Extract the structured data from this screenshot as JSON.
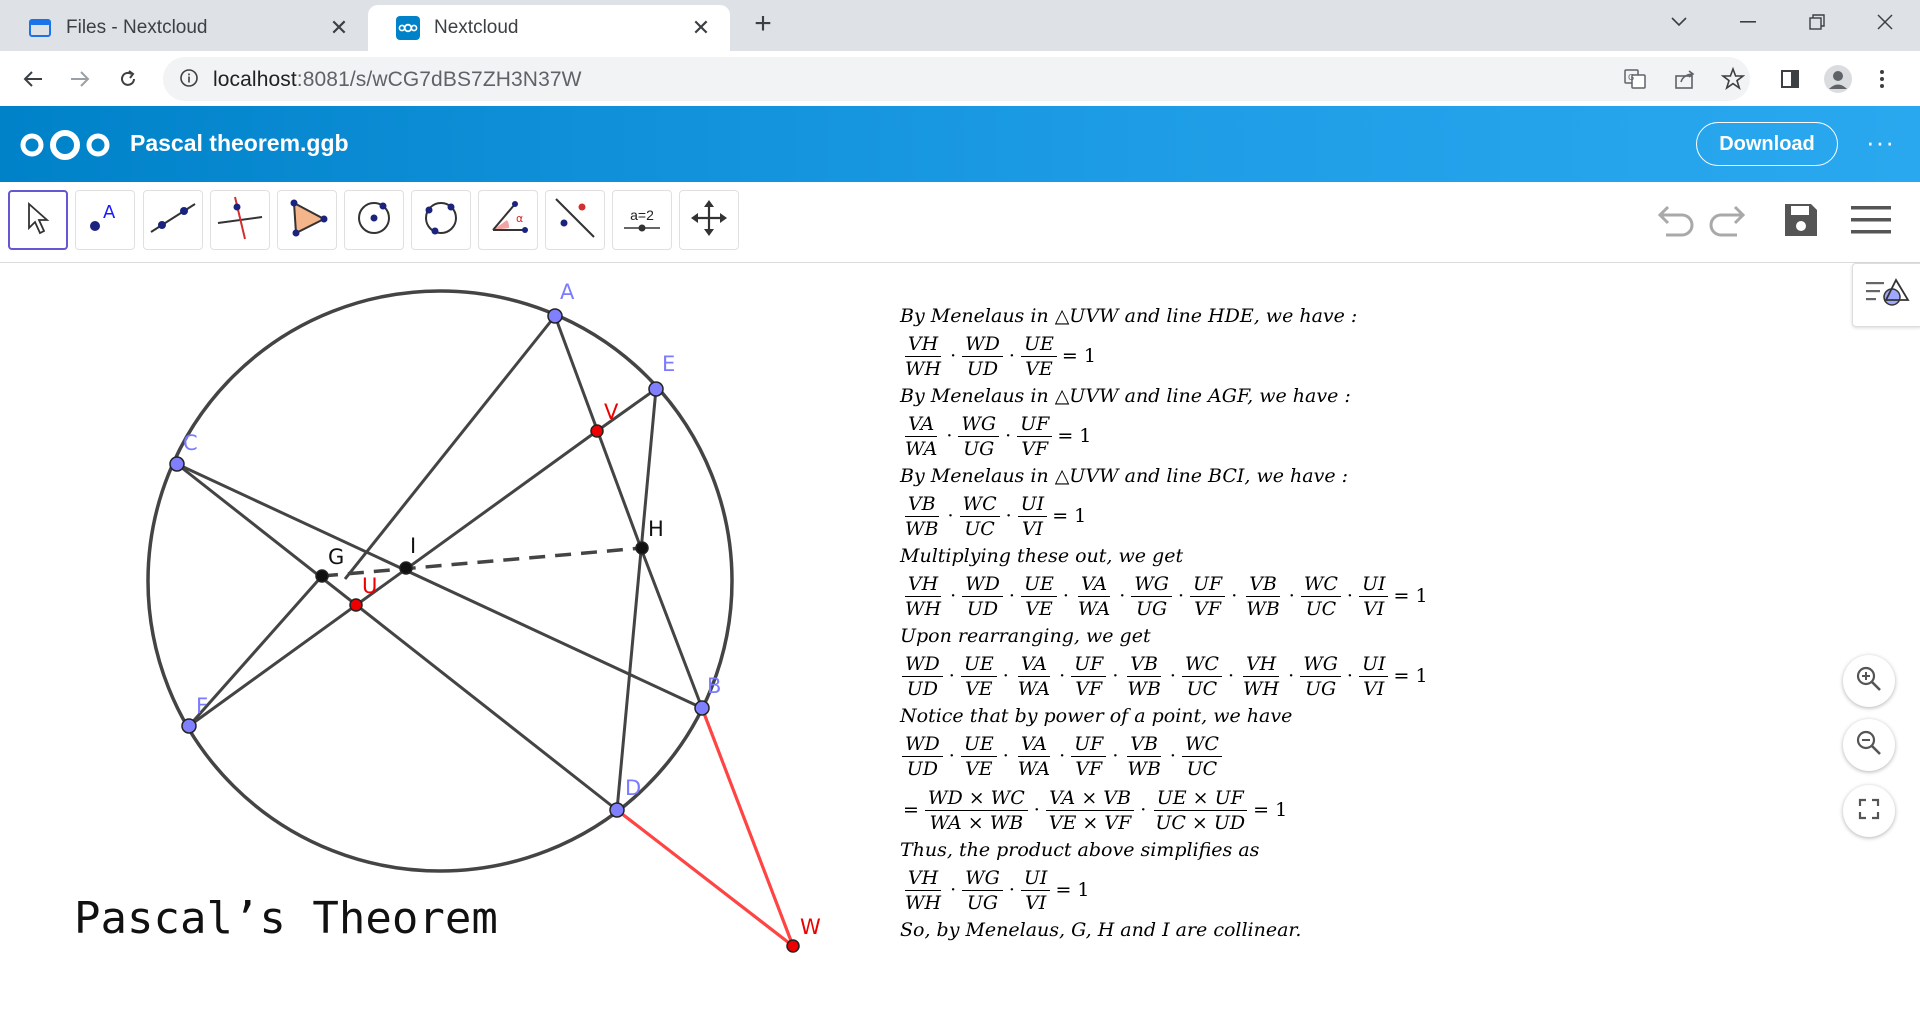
{
  "browser": {
    "tabs": [
      {
        "title": "Files - Nextcloud",
        "icon": "folder-icon"
      },
      {
        "title": "Nextcloud",
        "icon": "nextcloud-icon"
      }
    ],
    "new_tab_label": "+",
    "url_host": "localhost",
    "url_rest": ":8081/s/wCG7dBS7ZH3N37W"
  },
  "nextcloud": {
    "file_title": "Pascal theorem.ggb",
    "download_label": "Download",
    "more_label": "···",
    "brand_color": "#0082c9"
  },
  "geogebra": {
    "tools": [
      "move-tool",
      "point-tool",
      "line-tool",
      "perpendicular-tool",
      "polygon-tool",
      "circle-center-tool",
      "circle-three-points-tool",
      "angle-tool",
      "reflect-tool",
      "slider-tool",
      "move-graphics-tool"
    ],
    "slider_tool_label": "a=2",
    "angle_tool_label": "α",
    "point_tool_label": "A",
    "theorem_title": "Pascal’s Theorem",
    "points": {
      "A": "A",
      "E": "E",
      "C": "C",
      "V": "V",
      "H": "H",
      "G": "G",
      "I": "I",
      "U": "U",
      "B": "B",
      "F": "F",
      "D": "D",
      "W": "W"
    },
    "proof": {
      "l1": "By  Menelaus  in  △UVW  and  line  HDE,  we  have :",
      "l3": "By  Menelaus  in  △UVW  and  line  AGF,  we   have :",
      "l5": "By  Menelaus  in  △UVW  and  line  BCI,  we  have :",
      "l7": "Multiplying these out, we get",
      "l9": "Upon rearranging, we get",
      "l11": "Notice that by power of a point, we have",
      "l14": "Thus, the product above simplifies as",
      "l16": "So, by Menelaus, G, H and I are collinear.",
      "eq1": [
        [
          "VH",
          "WH"
        ],
        [
          "WD",
          "UD"
        ],
        [
          "UE",
          "VE"
        ]
      ],
      "eq2": [
        [
          "VA",
          "WA"
        ],
        [
          "WG",
          "UG"
        ],
        [
          "UF",
          "VF"
        ]
      ],
      "eq3": [
        [
          "VB",
          "WB"
        ],
        [
          "WC",
          "UC"
        ],
        [
          "UI",
          "VI"
        ]
      ],
      "eq4": [
        [
          "VH",
          "WH"
        ],
        [
          "WD",
          "UD"
        ],
        [
          "UE",
          "VE"
        ],
        [
          "VA",
          "WA"
        ],
        [
          "WG",
          "UG"
        ],
        [
          "UF",
          "VF"
        ],
        [
          "VB",
          "WB"
        ],
        [
          "WC",
          "UC"
        ],
        [
          "UI",
          "VI"
        ]
      ],
      "eq5": [
        [
          "WD",
          "UD"
        ],
        [
          "UE",
          "VE"
        ],
        [
          "VA",
          "WA"
        ],
        [
          "UF",
          "VF"
        ],
        [
          "VB",
          "WB"
        ],
        [
          "WC",
          "UC"
        ],
        [
          "VH",
          "WH"
        ],
        [
          "WG",
          "UG"
        ],
        [
          "UI",
          "VI"
        ]
      ],
      "eq6": [
        [
          "WD",
          "UD"
        ],
        [
          "UE",
          "VE"
        ],
        [
          "VA",
          "WA"
        ],
        [
          "UF",
          "VF"
        ],
        [
          "VB",
          "WB"
        ],
        [
          "WC",
          "UC"
        ]
      ],
      "eq7": [
        [
          "WD × WC",
          "WA × WB"
        ],
        [
          "VA × VB",
          "VE × VF"
        ],
        [
          "UE × UF",
          "UC × UD"
        ]
      ],
      "eq8": [
        [
          "VH",
          "WH"
        ],
        [
          "WG",
          "UG"
        ],
        [
          "UI",
          "VI"
        ]
      ],
      "rhs": "= 1",
      "lhs_eq": "="
    }
  }
}
